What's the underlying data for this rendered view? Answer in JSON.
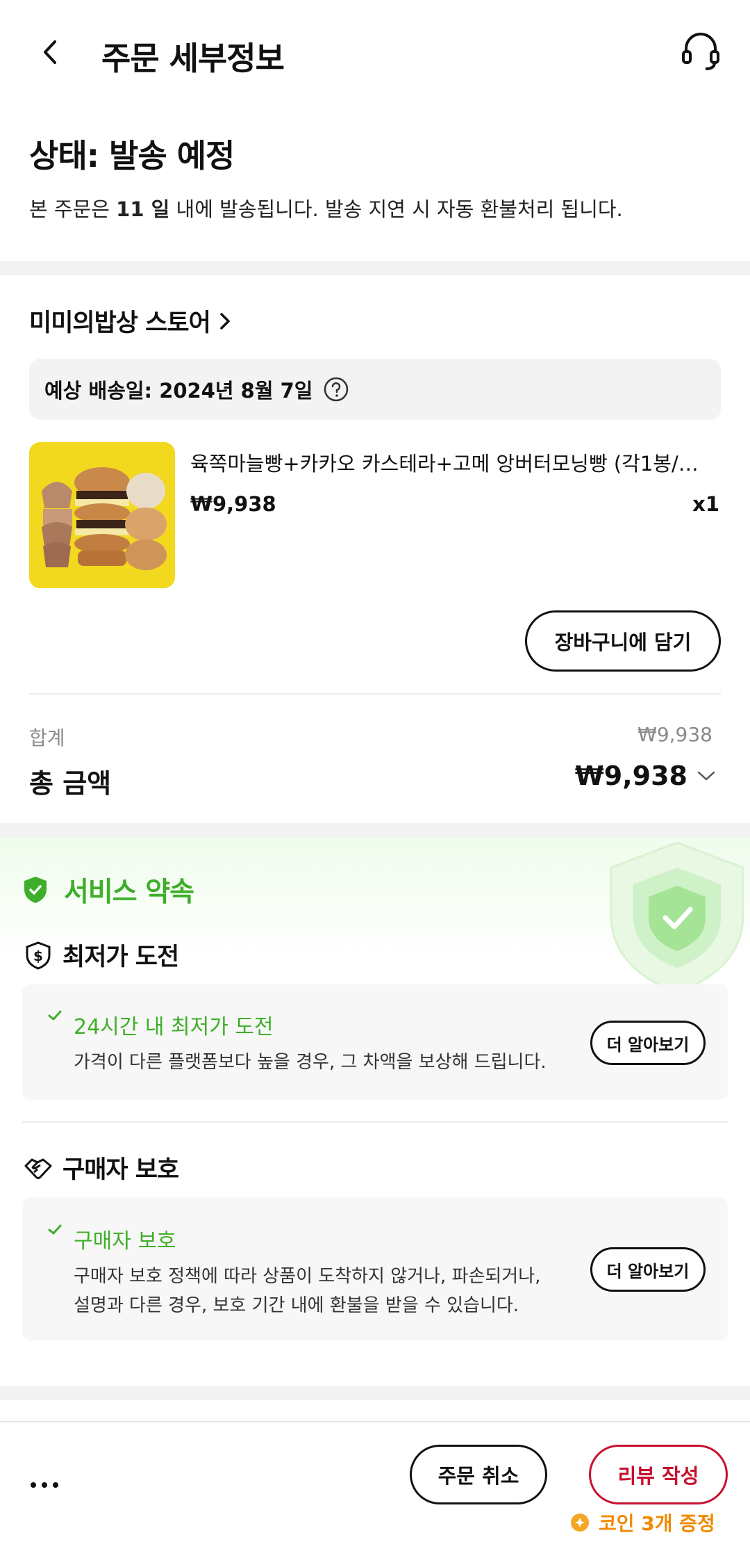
{
  "header": {
    "title": "주문 세부정보"
  },
  "status": {
    "title": "상태: 발송 예정",
    "desc_before": "본 주문은 ",
    "desc_days": "11 일",
    "desc_after": " 내에 발송됩니다. 발송 지연 시 자동 환불처리 됩니다."
  },
  "store": {
    "name": "미미의밥상 스토어",
    "delivery": "예상 배송일: 2024년 8월 7일"
  },
  "product": {
    "name": "육쪽마늘빵+카카오 카스테라+고메 앙버터모닝빵 (각1봉/…",
    "price": "₩9,938",
    "qty": "x1",
    "cart_button": "장바구니에 담기"
  },
  "totals": {
    "subtotal_label": "합계",
    "subtotal_value": "₩9,938",
    "total_label": "총 금액",
    "total_value": "₩9,938"
  },
  "service": {
    "title": "서비스 약속",
    "sections": [
      {
        "title": "최저가 도전",
        "card_title": "24시간 내 최저가 도전",
        "card_lines": [
          "가격이 다른 플랫폼보다 높을 경우, 그 차액을 보상해 드립니다."
        ],
        "button": "더 알아보기"
      },
      {
        "title": "구매자 보호",
        "card_title": "구매자 보호",
        "card_lines": [
          "구매자 보호 정책에 따라 상품이 도착하지 않거나, 파손되거나,",
          "설명과 다른 경우, 보호 기간 내에 환불을 받을 수 있습니다."
        ],
        "button": "더 알아보기"
      }
    ]
  },
  "bottom": {
    "cancel": "주문 취소",
    "review": "리뷰 작성",
    "coin": "코인 3개 증정"
  },
  "colors": {
    "green": "#3fae2a",
    "red": "#c8102e",
    "orange": "#f08a00"
  }
}
